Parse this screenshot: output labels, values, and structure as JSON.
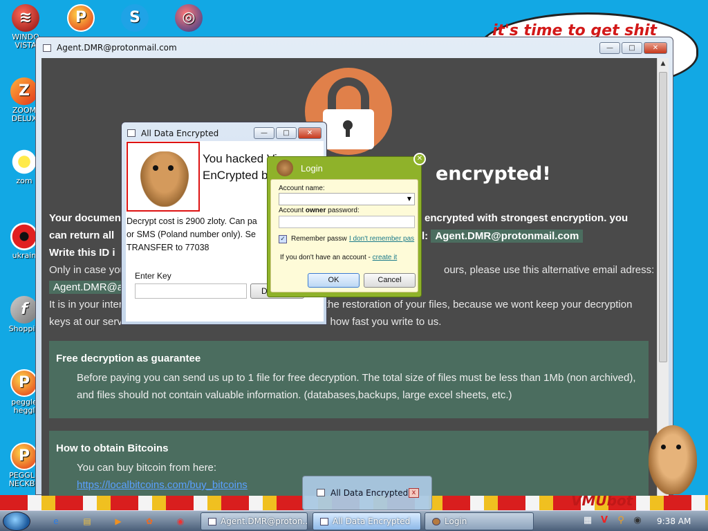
{
  "desktop": {
    "icons": [
      {
        "label": "WINDO\nVISTA",
        "glyph": "≋"
      },
      {
        "label": "",
        "glyph": "P"
      },
      {
        "label": "",
        "glyph": "S"
      },
      {
        "label": "",
        "glyph": "◎"
      },
      {
        "label": "ZOOM\nDELUX",
        "glyph": "Z"
      },
      {
        "label": "zom",
        "glyph": ""
      },
      {
        "label": "ukrain",
        "glyph": ""
      },
      {
        "label": "Shoppin",
        "glyph": "f"
      },
      {
        "label": "peggle\nheggl",
        "glyph": "P"
      },
      {
        "label": "PEGGLE\nNECKBE",
        "glyph": "P"
      }
    ],
    "speech_text": "it's time to get shit",
    "corner_text": "VMUbot"
  },
  "main_window": {
    "title": "Agent.DMR@protonmail.com",
    "buttons": {
      "minimize": "—",
      "maximize": "□",
      "close": "✕"
    },
    "headline": "encrypted!",
    "line1_start": "Your documen",
    "line1_end": "encrypted with strongest encryption. you",
    "line2_start": "can return all",
    "line2_end_label": "l:",
    "email": "Agent.DMR@protonmail.com",
    "line3": "Write this ID i",
    "line4_start": "Only in case you",
    "line4_end": "ours, please use this alternative email adress:",
    "alt_email": "Agent.DMR@ac",
    "line6_start": "It is in your inter",
    "line6_end": "the restoration of your files, because we wont keep your decryption",
    "line7_start": "keys at our serv",
    "line7_end": "n how fast you write to us.",
    "guarantee": {
      "heading": "Free decryption as guarantee",
      "line1": "Before paying you can send us up to 1 file for free decryption. The total size of files must be less than 1Mb (non archived),",
      "line2": "and files should not contain valuable information. (databases,backups, large excel sheets, etc.)"
    },
    "bitcoins": {
      "heading": "How to obtain Bitcoins",
      "line1": "You can buy bitcoin from here:",
      "link": "https://localbitcoins.com/buy_bitcoins"
    }
  },
  "ade_dialog": {
    "title": "All Data Encrypted",
    "big_line1": "You hacked",
    "big_line1_suffix": " Vi",
    "big_line2": "EnCrypted b",
    "small_line1": "Decrypt cost is 2900 zloty. Can pa",
    "small_line2": "or SMS (Poland number only). Se",
    "small_line3": "TRANSFER to 77038",
    "key_label": "Enter Key",
    "key_value": "",
    "decrypt_button": "D"
  },
  "login_dialog": {
    "title": "Login",
    "account_name_label": "Account name:",
    "account_name_value": "",
    "password_label_pre": "Account ",
    "password_label_bold": "owner",
    "password_label_post": " password:",
    "remember": "Remember passw",
    "remember_checked": "✓",
    "forgot": "I don't remember pas",
    "no_account": "If you don't have an account - ",
    "create": "create it",
    "ok": "OK",
    "cancel": "Cancel"
  },
  "taskbar_preview": {
    "label": "All Data Encrypted",
    "close": "x"
  },
  "taskbar": {
    "quick": [
      {
        "glyph": "e"
      },
      {
        "glyph": "▤"
      },
      {
        "glyph": "▶"
      },
      {
        "glyph": "✿"
      },
      {
        "glyph": "◉"
      }
    ],
    "tasks": [
      {
        "label": "Agent.DMR@proton..."
      },
      {
        "label": "All Data Encrypted"
      },
      {
        "label": "Login"
      }
    ],
    "tray": [
      {
        "glyph": "▦"
      },
      {
        "glyph": "V"
      },
      {
        "glyph": "⚲"
      },
      {
        "glyph": "◉"
      }
    ],
    "clock": "9:38 AM"
  }
}
